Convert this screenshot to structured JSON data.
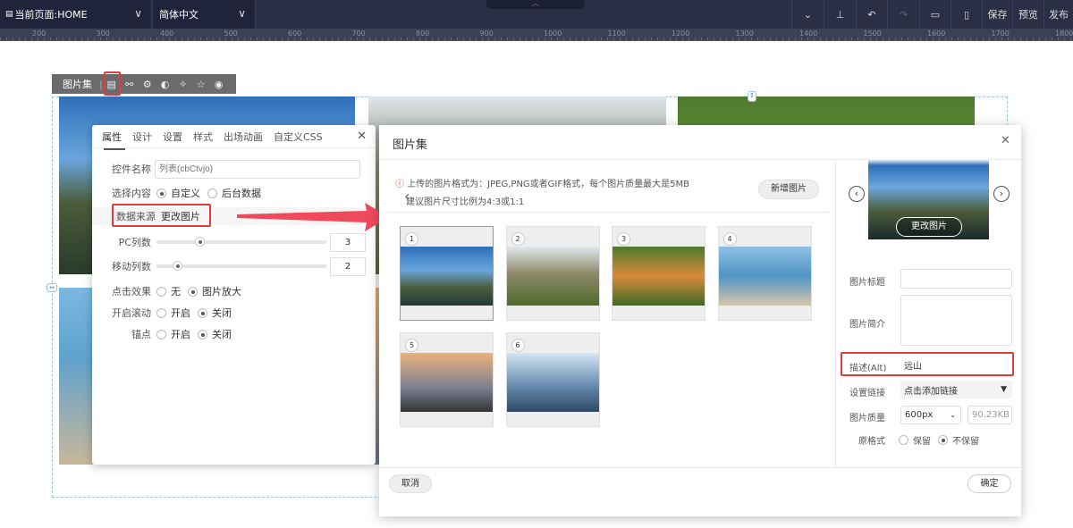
{
  "topbar": {
    "page_select": "当前页面:HOME",
    "lang_select": "简体中文",
    "save": "保存",
    "preview": "预览",
    "publish": "发布"
  },
  "ruler": [
    "200",
    "300",
    "400",
    "500",
    "600",
    "700",
    "800",
    "900",
    "1000",
    "1100",
    "1200",
    "1300",
    "1400",
    "1500",
    "1600",
    "1700",
    "1800"
  ],
  "component_toolbar": {
    "label": "图片集"
  },
  "props_panel": {
    "tabs": [
      "属性",
      "设计",
      "设置",
      "样式",
      "出场动画",
      "自定义CSS"
    ],
    "name_label": "控件名称",
    "name_placeholder": "列表(cbCtvjo)",
    "content_label": "选择内容",
    "content_opt1": "自定义",
    "content_opt2": "后台数据",
    "source_label": "数据来源",
    "source_value": "更改图片",
    "pc_cols_label": "PC列数",
    "pc_cols": "3",
    "pc_cols_fraction": 0.25,
    "mobile_cols_label": "移动列数",
    "mobile_cols": "2",
    "mobile_cols_fraction": 0.12,
    "click_label": "点击效果",
    "click_opt1": "无",
    "click_opt2": "图片放大",
    "scroll_label": "开启滚动",
    "scroll_opt1": "开启",
    "scroll_opt2": "关闭",
    "anchor_label": "锚点",
    "anchor_opt1": "开启",
    "anchor_opt2": "关闭"
  },
  "modal": {
    "title": "图片集",
    "notice": "上传的图片格式为：JPEG,PNG或者GIF格式，每个图片质量最大是5MB",
    "notice2": "建议图片尺寸比例为4:3或1:1",
    "add_button": "新增图片",
    "thumbs": [
      "1",
      "2",
      "3",
      "4",
      "5",
      "6"
    ],
    "change_image": "更改图片",
    "title_label": "图片标题",
    "intro_label": "图片简介",
    "alt_label": "描述(Alt)",
    "alt_value": "远山",
    "link_label": "设置链接",
    "link_value": "点击添加链接",
    "quality_label": "图片质量",
    "quality_value": "600px",
    "size_value": "90.23KB",
    "format_label": "原格式",
    "format_opt1": "保留",
    "format_opt2": "不保留",
    "cancel": "取消",
    "ok": "确定"
  }
}
